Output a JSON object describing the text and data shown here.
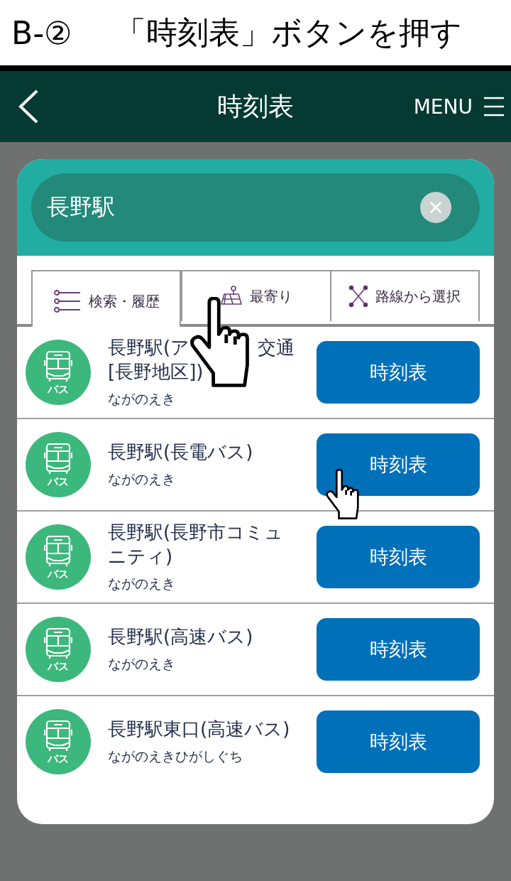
{
  "instruction": {
    "step": "B-②",
    "text": "「時刻表」ボタンを押す"
  },
  "header": {
    "title": "時刻表",
    "menu_label": "MENU"
  },
  "search": {
    "value": "長野駅"
  },
  "tabs": [
    {
      "label": "検索・履歴",
      "selected": true,
      "kind": "list"
    },
    {
      "label": "最寄り",
      "selected": false,
      "kind": "map"
    },
    {
      "label": "路線から選択",
      "selected": false,
      "kind": "route"
    }
  ],
  "stops": [
    {
      "name_lines": [
        [
          "長野駅(ア",
          "交通"
        ],
        [
          "[長野地区])"
        ]
      ],
      "reading": "ながのえき",
      "badge": "バス",
      "button": "時刻表"
    },
    {
      "name_lines": [
        [
          "長野駅(長電バス)"
        ]
      ],
      "reading": "ながのえき",
      "badge": "バス",
      "button": "時刻表"
    },
    {
      "name_lines": [
        [
          "長野駅(長野市コミュ"
        ],
        [
          "ニティ)"
        ]
      ],
      "reading": "ながのえき",
      "badge": "バス",
      "button": "時刻表"
    },
    {
      "name_lines": [
        [
          "長野駅(高速バス)"
        ]
      ],
      "reading": "ながのえき",
      "badge": "バス",
      "button": "時刻表"
    },
    {
      "name_lines": [
        [
          "長野駅東口(高速バス)"
        ]
      ],
      "reading": "ながのえきひがしぐち",
      "badge": "バス",
      "button": "時刻表"
    }
  ]
}
